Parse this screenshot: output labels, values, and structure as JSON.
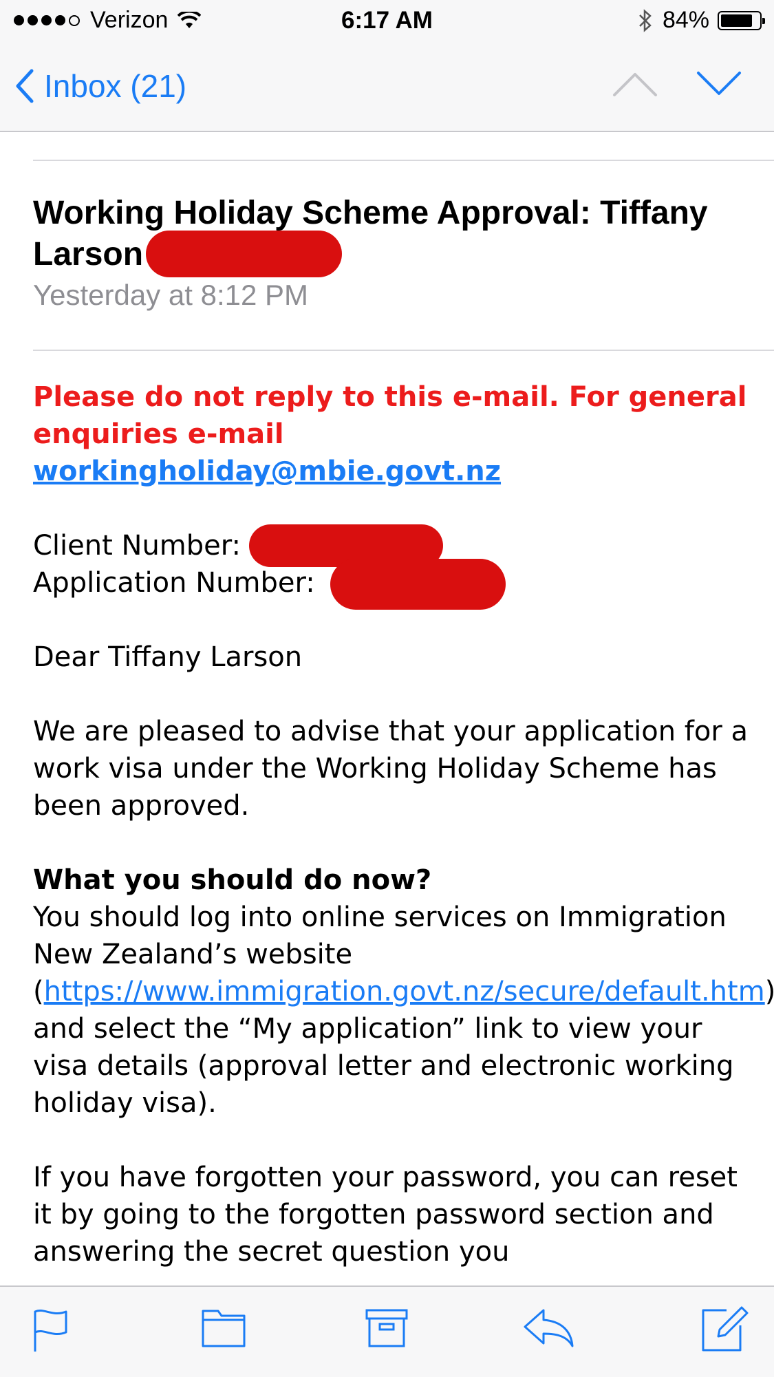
{
  "status": {
    "carrier": "Verizon",
    "time": "6:17 AM",
    "battery": "84%"
  },
  "nav": {
    "back_label": "Inbox (21)"
  },
  "email": {
    "subject": "Working Holiday Scheme Approval: Tiffany Larson",
    "date": "Yesterday at 8:12 PM",
    "warning_text": "Please do not reply to this e-mail. For general enquiries e-mail",
    "warning_email": "workingholiday@mbie.govt.nz",
    "client_label": "Client Number:",
    "application_label": "Application Number:",
    "greeting": "Dear Tiffany Larson",
    "para1": "We are pleased to advise that your application for a work visa under the Working Holiday Scheme has been approved.",
    "heading": "What you should do now?",
    "para2_a": "You should log into online services on Immigration New Zealand’s website (",
    "para2_link": "https://www.immigration.govt.nz/secure/default.htm",
    "para2_b": ") and select the “My application” link to view your visa details (approval letter and electronic working holiday visa).",
    "para3": "If you have forgotten your password, you can reset it by going to the forgotten password section and answering the secret question you"
  },
  "icons": {
    "flag": "flag-icon",
    "folder": "folder-icon",
    "archive": "archive-icon",
    "reply": "reply-icon",
    "compose": "compose-icon"
  },
  "colors": {
    "accent": "#1a7cf5",
    "warning": "#ec1c1c",
    "redaction": "#d90f0f",
    "meta": "#8e8e93"
  }
}
